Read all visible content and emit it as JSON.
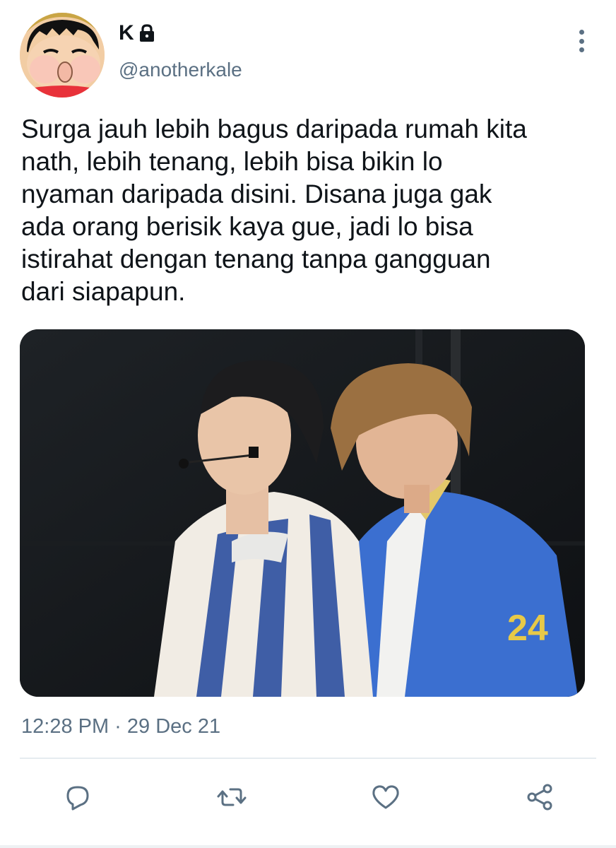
{
  "author": {
    "display_name": "K",
    "handle": "@anotherkale",
    "avatar_icon": "cartoon-avatar",
    "protected_icon": "lock-icon"
  },
  "tweet": {
    "text": "Surga jauh lebih bagus daripada rumah kita\nnath, lebih tenang, lebih bisa bikin lo\nnyaman daripada disini. Disana juga gak\nada orang berisik kaya gue, jadi lo bisa\nistirahat dengan tenang tanpa gangguan\ndari siapapun.",
    "timestamp": "12:28 PM · 29 Dec 21",
    "media_description_icon": "photo-two-performers-on-stage"
  },
  "actions": [
    {
      "name": "reply",
      "icon": "reply-icon"
    },
    {
      "name": "retweet",
      "icon": "retweet-icon"
    },
    {
      "name": "like",
      "icon": "heart-icon"
    },
    {
      "name": "share",
      "icon": "share-icon"
    }
  ],
  "colors": {
    "text": "#0f1419",
    "secondary": "#5b7083",
    "divider": "#e6ecf0"
  }
}
